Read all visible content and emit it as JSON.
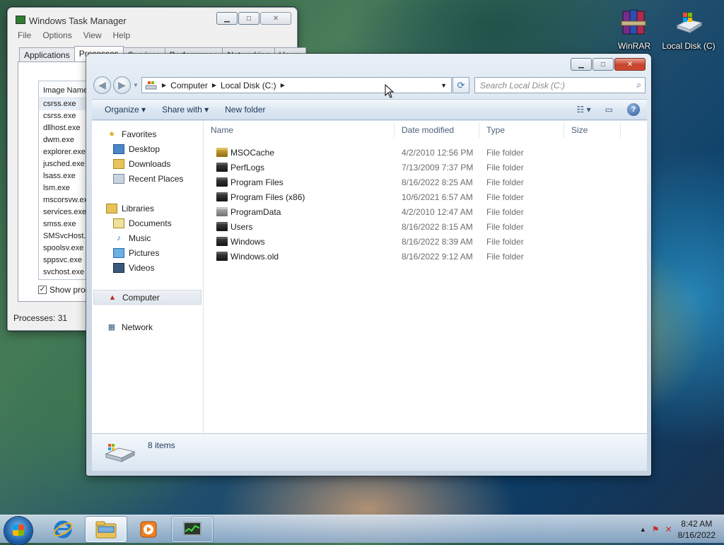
{
  "desktop": {
    "icons": [
      {
        "label": "WinRAR",
        "icon": "winrar-icon"
      },
      {
        "label": "Local Disk (C)",
        "icon": "local-disk-icon"
      }
    ]
  },
  "task_manager": {
    "title": "Windows Task Manager",
    "menu": [
      "File",
      "Options",
      "View",
      "Help"
    ],
    "tabs": [
      "Applications",
      "Processes",
      "Services",
      "Performance",
      "Networking",
      "Users"
    ],
    "active_tab": "Processes",
    "column_header": "Image Name",
    "processes": [
      "csrss.exe",
      "csrss.exe",
      "dllhost.exe",
      "dwm.exe",
      "explorer.exe",
      "jusched.exe",
      "lsass.exe",
      "lsm.exe",
      "mscorsvw.exe",
      "services.exe",
      "smss.exe",
      "SMSvcHost.exe",
      "spoolsv.exe",
      "sppsvc.exe",
      "svchost.exe"
    ],
    "show_processes_label": "Show processes from all users",
    "show_processes_checked": true,
    "status": "Processes: 31"
  },
  "explorer": {
    "breadcrumb": [
      "Computer",
      "Local Disk (C:)"
    ],
    "search_placeholder": "Search Local Disk (C:)",
    "toolbar": {
      "organize": "Organize",
      "share_with": "Share with",
      "new_folder": "New folder"
    },
    "nav": {
      "favorites": {
        "label": "Favorites",
        "items": [
          "Desktop",
          "Downloads",
          "Recent Places"
        ]
      },
      "libraries": {
        "label": "Libraries",
        "items": [
          "Documents",
          "Music",
          "Pictures",
          "Videos"
        ]
      },
      "computer": "Computer",
      "network": "Network"
    },
    "columns": {
      "name": "Name",
      "date": "Date modified",
      "type": "Type",
      "size": "Size"
    },
    "files": [
      {
        "name": "MSOCache",
        "date": "4/2/2010 12:56 PM",
        "type": "File folder"
      },
      {
        "name": "PerfLogs",
        "date": "7/13/2009 7:37 PM",
        "type": "File folder"
      },
      {
        "name": "Program Files",
        "date": "8/16/2022 8:25 AM",
        "type": "File folder"
      },
      {
        "name": "Program Files (x86)",
        "date": "10/6/2021 6:57 AM",
        "type": "File folder"
      },
      {
        "name": "ProgramData",
        "date": "4/2/2010 12:47 AM",
        "type": "File folder"
      },
      {
        "name": "Users",
        "date": "8/16/2022 8:15 AM",
        "type": "File folder"
      },
      {
        "name": "Windows",
        "date": "8/16/2022 8:39 AM",
        "type": "File folder"
      },
      {
        "name": "Windows.old",
        "date": "8/16/2022 9:12 AM",
        "type": "File folder"
      }
    ],
    "item_count": "8 items"
  },
  "taskbar": {
    "time": "8:42 AM",
    "date": "8/16/2022"
  }
}
